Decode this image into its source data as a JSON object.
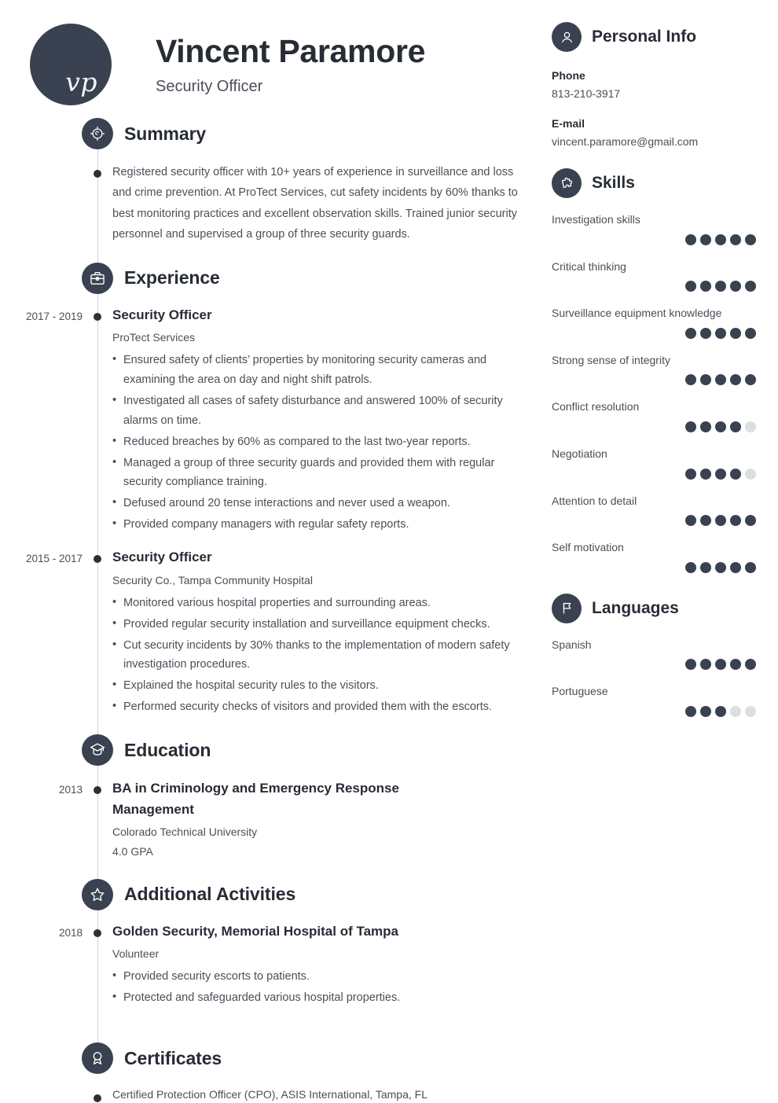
{
  "theme": {
    "dark": "#3a4150",
    "heading": "#272c35",
    "body": "#4a4f58",
    "dot_off": "#dcdee1",
    "line": "#d3d5d9"
  },
  "header": {
    "monogram": "vp",
    "name": "Vincent Paramore",
    "job_title": "Security Officer"
  },
  "sections": {
    "summary": {
      "title": "Summary",
      "icon": "target-icon",
      "text": "Registered security officer with 10+ years of experience in surveillance and loss and crime prevention. At ProTect Services, cut safety incidents by 60% thanks to best monitoring practices and excellent observation skills. Trained junior security personnel and supervised a group of three security guards."
    },
    "experience": {
      "title": "Experience",
      "icon": "briefcase-icon",
      "entries": [
        {
          "date": "2017 - 2019",
          "title": "Security Officer",
          "subtitle": "ProTect Services",
          "bullets": [
            "Ensured safety of clients’ properties by monitoring security cameras and examining the area on day and night shift patrols.",
            "Investigated all cases of safety disturbance and answered 100% of security alarms on time.",
            "Reduced breaches by 60% as compared to the last two-year reports.",
            "Managed a group of three security guards and provided them with regular security compliance training.",
            "Defused around 20 tense interactions and never used a weapon.",
            "Provided company managers with regular safety reports."
          ]
        },
        {
          "date": "2015 - 2017",
          "title": "Security Officer",
          "subtitle": "Security Co., Tampa Community Hospital",
          "bullets": [
            "Monitored various hospital properties and surrounding areas.",
            "Provided regular security installation and surveillance equipment checks.",
            "Cut security incidents by 30% thanks to the implementation of modern safety investigation procedures.",
            "Explained the hospital security rules to the visitors.",
            "Performed security checks of visitors and provided them with the escorts."
          ]
        }
      ]
    },
    "education": {
      "title": "Education",
      "icon": "graduation-cap-icon",
      "entries": [
        {
          "date": "2013",
          "title": "BA in Criminology and Emergency Response Management",
          "subtitle": "Colorado Technical University",
          "subtitle2": "4.0 GPA"
        }
      ]
    },
    "activities": {
      "title": "Additional Activities",
      "icon": "star-icon",
      "entries": [
        {
          "date": "2018",
          "title": "Golden Security, Memorial Hospital of Tampa",
          "subtitle": "Volunteer",
          "bullets": [
            "Provided security escorts to patients.",
            "Protected and safeguarded various hospital properties."
          ]
        }
      ]
    },
    "certificates": {
      "title": "Certificates",
      "icon": "award-ribbon-icon",
      "entries": [
        {
          "text": "Certified Protection Officer (CPO), ASIS International, Tampa, FL"
        }
      ]
    }
  },
  "sidebar": {
    "personal_info": {
      "title": "Personal Info",
      "icon": "person-icon",
      "fields": [
        {
          "label": "Phone",
          "value": "813-210-3917"
        },
        {
          "label": "E-mail",
          "value": "vincent.paramore@gmail.com"
        }
      ]
    },
    "skills": {
      "title": "Skills",
      "icon": "puzzle-icon",
      "max": 5,
      "items": [
        {
          "label": "Investigation skills",
          "level": 5
        },
        {
          "label": "Critical thinking",
          "level": 5
        },
        {
          "label": "Surveillance equipment knowledge",
          "level": 5
        },
        {
          "label": "Strong sense of integrity",
          "level": 5
        },
        {
          "label": "Conflict resolution",
          "level": 4
        },
        {
          "label": "Negotiation",
          "level": 4
        },
        {
          "label": "Attention to detail",
          "level": 5
        },
        {
          "label": "Self motivation",
          "level": 5
        }
      ]
    },
    "languages": {
      "title": "Languages",
      "icon": "flag-icon",
      "max": 5,
      "items": [
        {
          "label": "Spanish",
          "level": 5
        },
        {
          "label": "Portuguese",
          "level": 3
        }
      ]
    }
  }
}
